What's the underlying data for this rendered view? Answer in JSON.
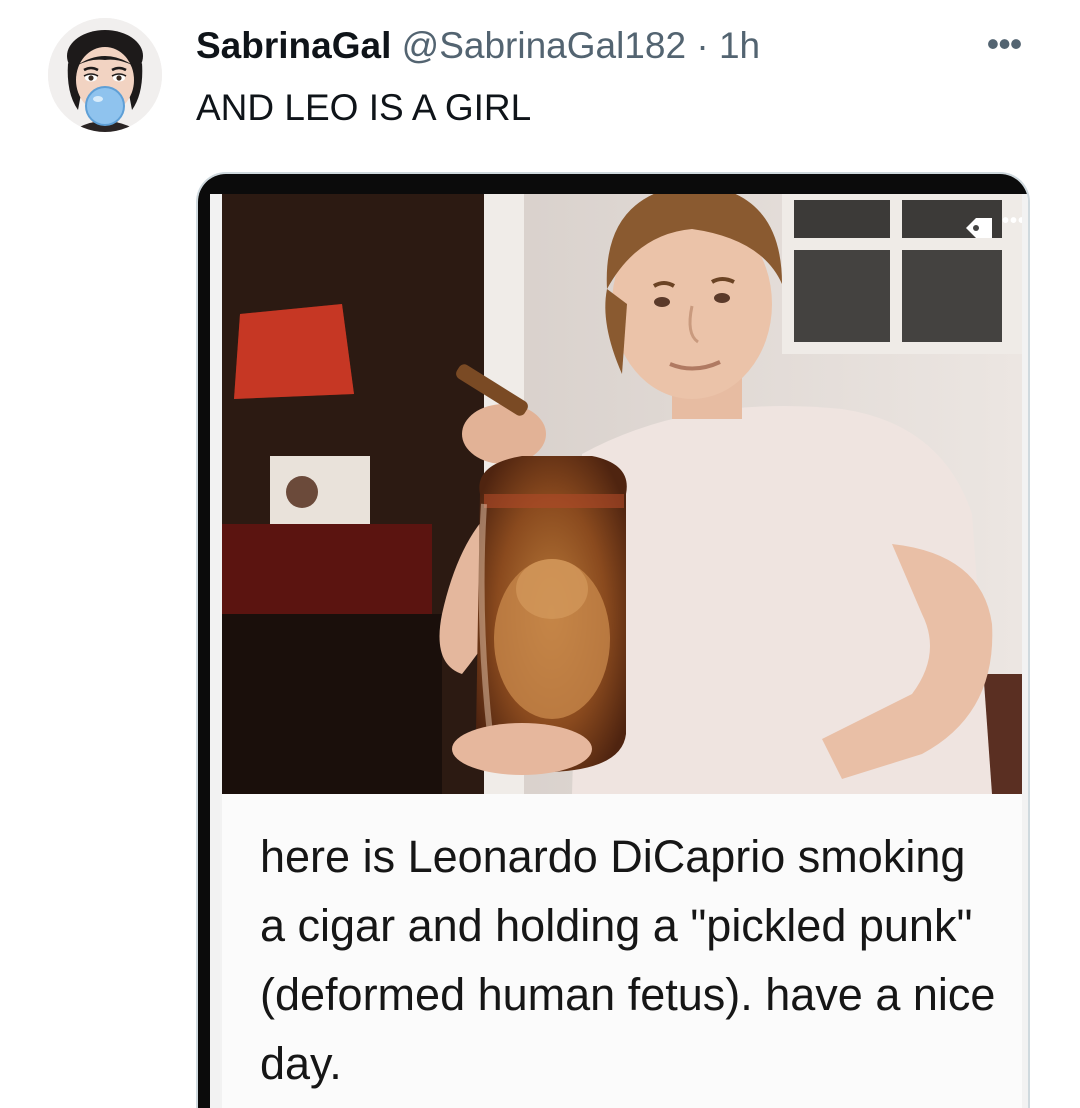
{
  "tweet": {
    "display_name": "SabrinaGal",
    "handle": "@SabrinaGal182",
    "separator": " · ",
    "time": "1h",
    "more_icon": "more-horizontal-icon",
    "more_glyph": "•••",
    "text": "AND LEO IS A GIRL"
  },
  "media": {
    "caption": "here is Leonardo DiCaprio smoking a cigar and holding a \"pickled punk\" (deformed human fetus). have a nice day.",
    "photo_more_glyph": "•••",
    "tag_icon": "tag-icon"
  },
  "colors": {
    "text_primary": "#0f1419",
    "text_secondary": "#536471",
    "card_border": "#cfd9de"
  }
}
